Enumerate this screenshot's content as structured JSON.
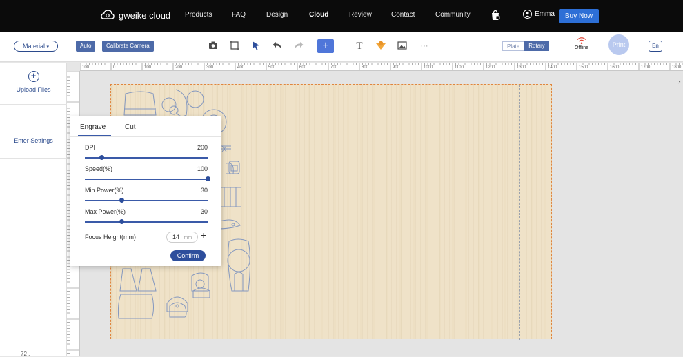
{
  "nav": {
    "brand": "gweike cloud",
    "links": [
      "Products",
      "FAQ",
      "Design",
      "Cloud",
      "Review",
      "Contact",
      "Community"
    ],
    "cart_icon": "cart-icon",
    "user_name": "Emma",
    "buy_label": "Buy Now",
    "colors": {
      "bar": "#0b0b0b",
      "buy": "#2d6fd6"
    }
  },
  "toolbar": {
    "material_label": "Material",
    "auto_label": "Auto",
    "calibrate_label": "Calibrate Camera",
    "tools": [
      "camera-icon",
      "crop-icon",
      "select-arrow-icon",
      "undo-icon",
      "redo-icon",
      "add-icon",
      "text-icon",
      "shape-icon",
      "image-icon",
      "more-icon"
    ],
    "add_glyph": "+",
    "text_glyph": "T",
    "more_glyph": "···",
    "plate_label": "Plate",
    "rotary_label": "Rotary",
    "status_label": "Offline",
    "print_label": "Print",
    "lang_label": "En"
  },
  "sidebar": {
    "upload_label": "Upload Files",
    "settings_label": "Enter Settings",
    "zoom_text": "72   ."
  },
  "ruler": {
    "top_ticks": [
      "100",
      "0",
      "100",
      "200",
      "300",
      "400",
      "500",
      "600",
      "700",
      "800",
      "900",
      "1000",
      "1100",
      "1200",
      "1300",
      "1400",
      "1500",
      "1600",
      "1700",
      "1800"
    ]
  },
  "panel": {
    "tabs": [
      "Engrave",
      "Cut"
    ],
    "active_tab": "Engrave",
    "params": [
      {
        "label": "DPI",
        "value": "200",
        "fraction": 0.14
      },
      {
        "label": "Speed(%)",
        "value": "100",
        "fraction": 1.0
      },
      {
        "label": "Min Power(%)",
        "value": "30",
        "fraction": 0.3
      },
      {
        "label": "Max Power(%)",
        "value": "30",
        "fraction": 0.3
      }
    ],
    "focus_label": "Focus Height(mm)",
    "focus_value": "14",
    "focus_unit": "mm",
    "minus": "—",
    "plus": "+",
    "confirm_label": "Confirm"
  }
}
